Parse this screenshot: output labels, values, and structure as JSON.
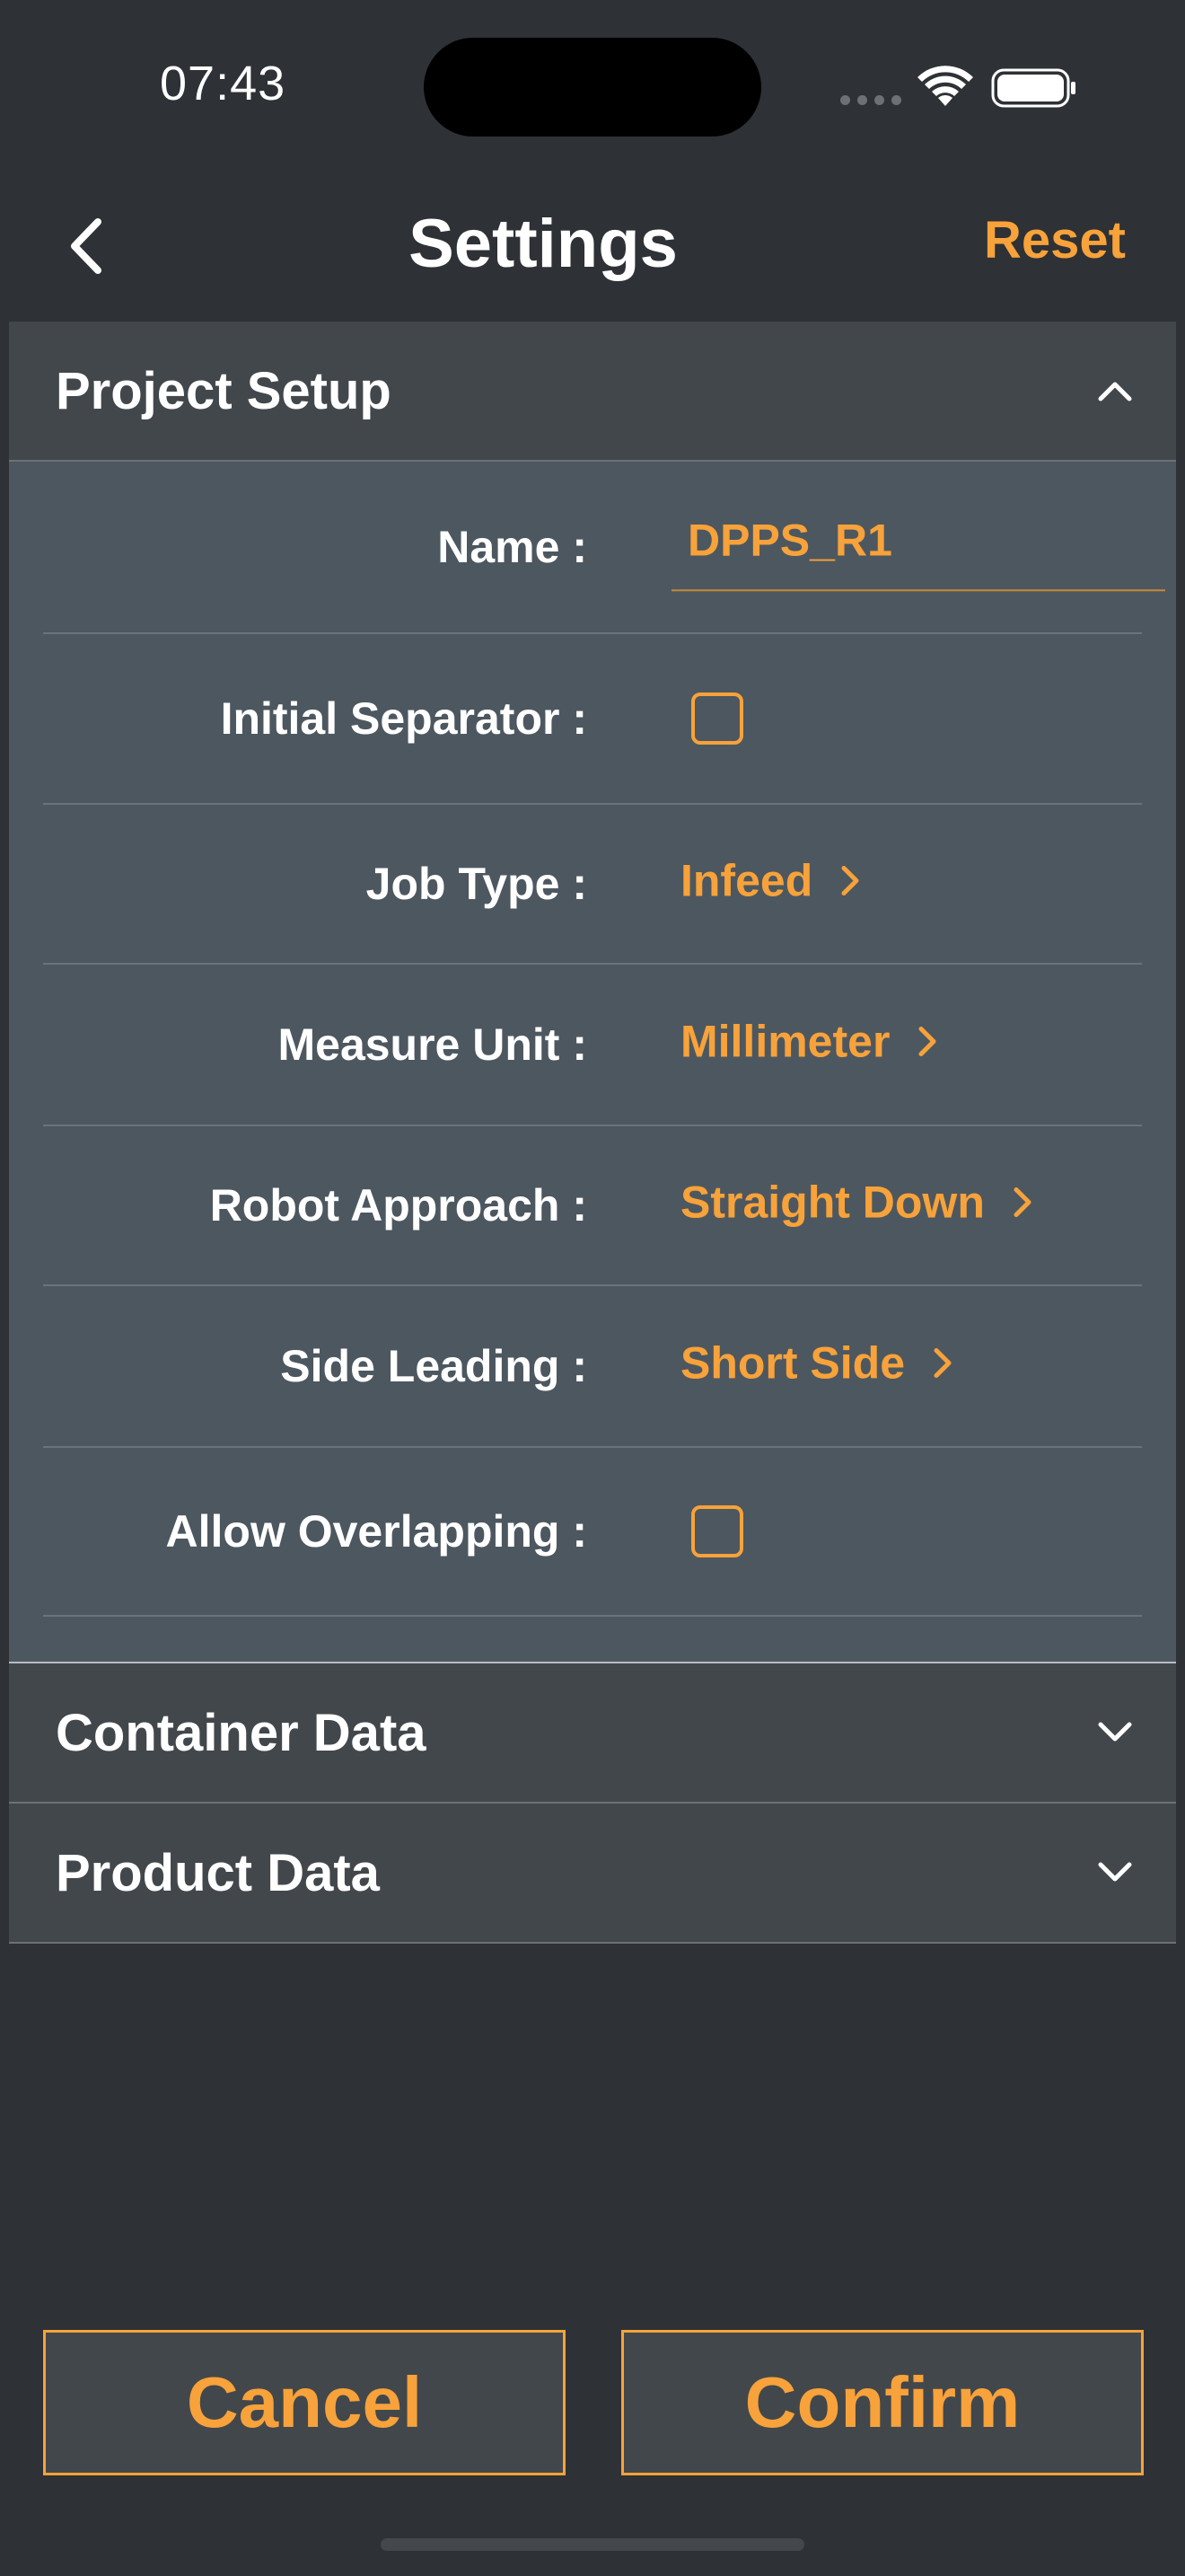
{
  "status_bar": {
    "time": "07:43"
  },
  "nav": {
    "title": "Settings",
    "reset_label": "Reset"
  },
  "sections": {
    "project_setup": {
      "title": "Project Setup",
      "rows": [
        {
          "label": "Name :",
          "value": "DPPS_R1"
        },
        {
          "label": "Initial Separator :",
          "checked": false
        },
        {
          "label": "Job Type :",
          "value": "Infeed"
        },
        {
          "label": "Measure Unit :",
          "value": "Millimeter"
        },
        {
          "label": "Robot Approach :",
          "value": "Straight Down"
        },
        {
          "label": "Side Leading :",
          "value": "Short Side"
        },
        {
          "label": "Allow Overlapping :",
          "checked": false
        }
      ]
    },
    "container_data": {
      "title": "Container Data"
    },
    "product_data": {
      "title": "Product Data"
    }
  },
  "footer": {
    "cancel_label": "Cancel",
    "confirm_label": "Confirm"
  },
  "colors": {
    "accent": "#f7a23a",
    "background": "#2e3135",
    "header": "#42474c",
    "panel": "#4d5760"
  }
}
